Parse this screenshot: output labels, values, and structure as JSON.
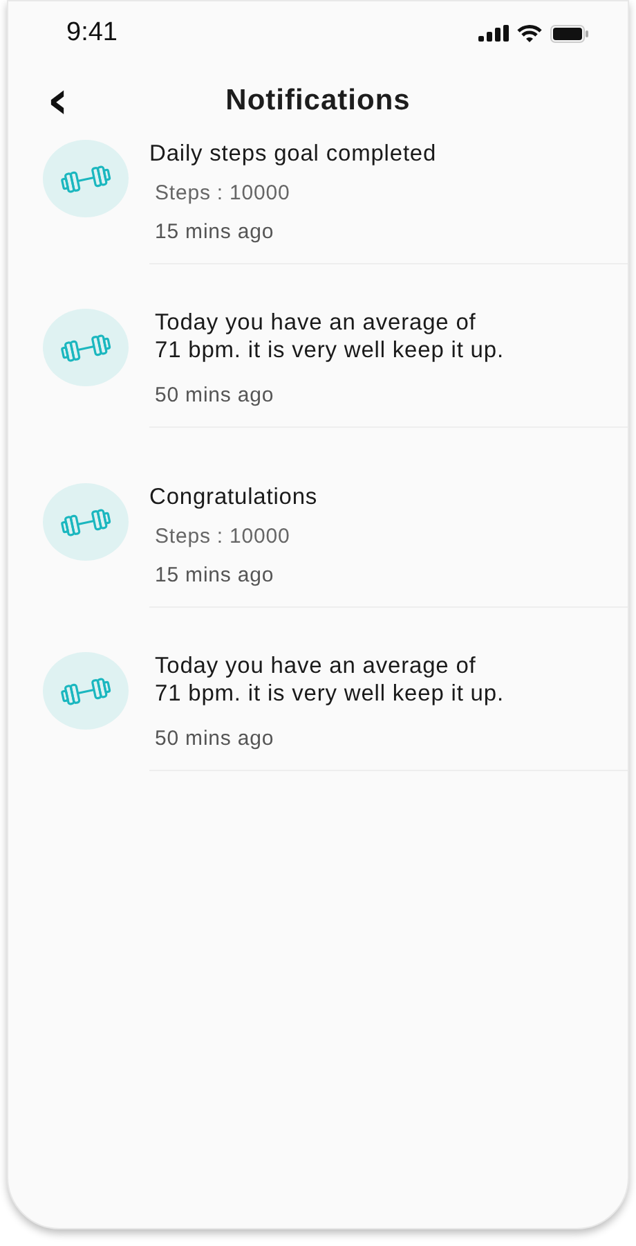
{
  "status_bar": {
    "time": "9:41"
  },
  "header": {
    "back": "‹",
    "title": "Notifications"
  },
  "notifications": [
    {
      "title": "Daily steps goal completed",
      "detail": "Steps : 10000",
      "time": "15 mins ago"
    },
    {
      "title": "Today you have an average of\n71 bpm. it is very well keep it up.",
      "time": "50 mins ago"
    },
    {
      "title": "Congratulations",
      "detail": "Steps : 10000",
      "time": "15 mins ago"
    },
    {
      "title": "Today you have an average of\n71 bpm. it is very well keep it up.",
      "time": "50 mins ago"
    }
  ]
}
